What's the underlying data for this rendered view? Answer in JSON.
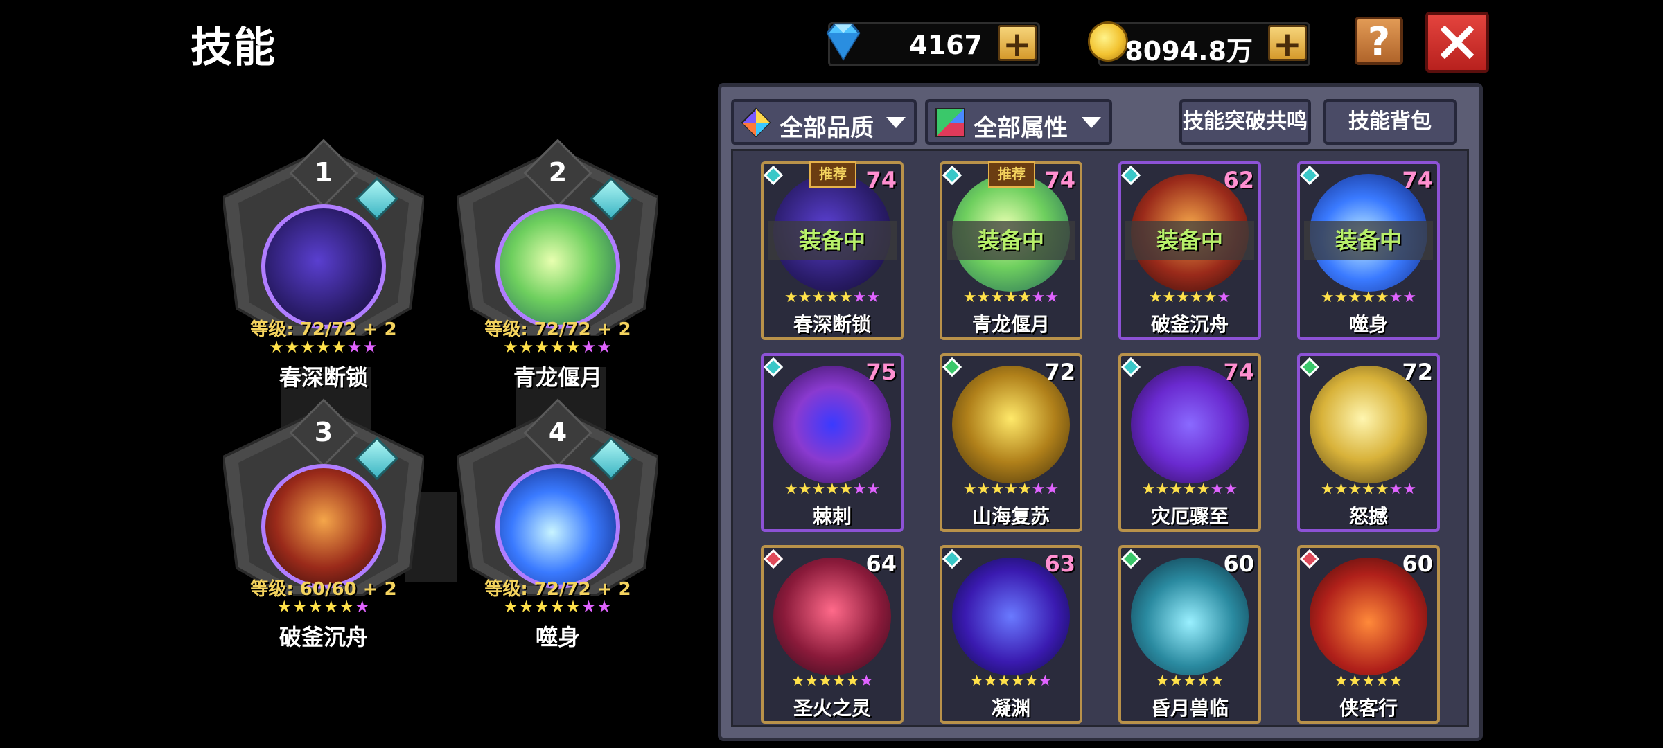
{
  "header": {
    "title": "技能"
  },
  "currency": {
    "gems": "4167",
    "gold": "8094.8万"
  },
  "colors": {
    "panel_bg": "#5c5d74",
    "card_gold_border": "#b9924a",
    "card_purple_border": "#8d52d6",
    "level_text": "#f4d35e",
    "equipped_text": "#b8f06a",
    "close_red": "#d12f2a"
  },
  "filters": {
    "quality": "全部品质",
    "attribute": "全部属性"
  },
  "actions": {
    "resonance": "技能突破共鸣",
    "bag": "技能背包"
  },
  "slots": [
    {
      "num": "1",
      "level": "等级: 72/72 + 2",
      "name": "春深断锁",
      "stars": [
        "y",
        "y",
        "y",
        "y",
        "y",
        "p",
        "p"
      ],
      "orb": "radial-gradient(circle at 45% 45%,#5a3fd0,#2a1c6a 60%,#120b2e)"
    },
    {
      "num": "2",
      "level": "等级: 72/72 + 2",
      "name": "青龙偃月",
      "stars": [
        "y",
        "y",
        "y",
        "y",
        "y",
        "p",
        "p"
      ],
      "orb": "radial-gradient(circle at 45% 45%,#e8ffb0,#6ecf5e 45%,#1d5f5a)"
    },
    {
      "num": "3",
      "level": "等级: 60/60 + 2",
      "name": "破釜沉舟",
      "stars": [
        "y",
        "y",
        "y",
        "y",
        "y",
        "p"
      ],
      "orb": "radial-gradient(circle at 50% 45%,#f4a64a,#9a2a1a 55%,#2a0a0a)"
    },
    {
      "num": "4",
      "level": "等级: 72/72 + 2",
      "name": "噬身",
      "stars": [
        "y",
        "y",
        "y",
        "y",
        "y",
        "p",
        "p"
      ],
      "orb": "radial-gradient(circle at 45% 55%,#c8f4ff,#3a7aff 45%,#0a1a6a)"
    }
  ],
  "cards": [
    {
      "level": "74",
      "name": "春深断锁",
      "equipped": "装备中",
      "recommended": "推荐",
      "stars": [
        "y",
        "y",
        "y",
        "y",
        "y",
        "p",
        "p"
      ],
      "border": "gold",
      "level_color": "#ff8fd0",
      "type": "teal",
      "orb": "radial-gradient(circle at 45% 45%,#5a3fd0,#2a1c6a 60%,#120b2e)"
    },
    {
      "level": "74",
      "name": "青龙偃月",
      "equipped": "装备中",
      "recommended": "推荐",
      "stars": [
        "y",
        "y",
        "y",
        "y",
        "y",
        "p",
        "p"
      ],
      "border": "gold",
      "level_color": "#ff8fd0",
      "type": "teal",
      "orb": "radial-gradient(circle at 45% 45%,#e8ffb0,#6ecf5e 45%,#1d5f5a)"
    },
    {
      "level": "62",
      "name": "破釜沉舟",
      "equipped": "装备中",
      "recommended": "",
      "stars": [
        "y",
        "y",
        "y",
        "y",
        "y",
        "p"
      ],
      "border": "purple",
      "level_color": "#ff8fd0",
      "type": "teal",
      "orb": "radial-gradient(circle at 50% 45%,#f4a64a,#9a2a1a 55%,#2a0a0a)"
    },
    {
      "level": "74",
      "name": "噬身",
      "equipped": "装备中",
      "recommended": "",
      "stars": [
        "y",
        "y",
        "y",
        "y",
        "y",
        "p",
        "p"
      ],
      "border": "purple",
      "level_color": "#ff8fd0",
      "type": "teal",
      "orb": "radial-gradient(circle at 45% 55%,#c8f4ff,#3a7aff 45%,#0a1a6a)"
    },
    {
      "level": "75",
      "name": "棘刺",
      "equipped": "",
      "recommended": "",
      "stars": [
        "y",
        "y",
        "y",
        "y",
        "y",
        "p",
        "p"
      ],
      "border": "purple",
      "level_color": "#ff8fd0",
      "type": "teal",
      "orb": "radial-gradient(circle at 50% 50%,#3a3aff,#8a3ad0 45%,#2a0a4a)"
    },
    {
      "level": "72",
      "name": "山海复苏",
      "equipped": "",
      "recommended": "",
      "stars": [
        "y",
        "y",
        "y",
        "y",
        "y",
        "p",
        "p"
      ],
      "border": "gold",
      "level_color": "#ffffff",
      "type": "green",
      "orb": "radial-gradient(circle at 50% 45%,#ffe96a,#b0801a 50%,#3a2a0a)"
    },
    {
      "level": "74",
      "name": "灾厄骤至",
      "equipped": "",
      "recommended": "",
      "stars": [
        "y",
        "y",
        "y",
        "y",
        "y",
        "p",
        "p"
      ],
      "border": "gold",
      "level_color": "#ff8fd0",
      "type": "teal",
      "orb": "radial-gradient(circle at 50% 50%,#8a6aff,#6a2ad0 50%,#2a0a4a)"
    },
    {
      "level": "72",
      "name": "怒撼",
      "equipped": "",
      "recommended": "",
      "stars": [
        "y",
        "y",
        "y",
        "y",
        "y",
        "p",
        "p"
      ],
      "border": "purple",
      "level_color": "#ffffff",
      "type": "green",
      "orb": "radial-gradient(circle at 45% 45%,#fff6b0,#d8b23a 45%,#3a2a0a)"
    },
    {
      "level": "64",
      "name": "圣火之灵",
      "equipped": "",
      "recommended": "",
      "stars": [
        "y",
        "y",
        "y",
        "y",
        "y",
        "p"
      ],
      "border": "gold",
      "level_color": "#ffffff",
      "type": "red",
      "orb": "radial-gradient(circle at 50% 45%,#ff6a8a,#8a1a3a 55%,#2a0a1a)"
    },
    {
      "level": "63",
      "name": "凝渊",
      "equipped": "",
      "recommended": "",
      "stars": [
        "y",
        "y",
        "y",
        "y",
        "y",
        "p"
      ],
      "border": "gold",
      "level_color": "#ff8fd0",
      "type": "teal",
      "orb": "radial-gradient(circle at 50% 50%,#6a7aff,#3a1ab0 55%,#0a0a3a)"
    },
    {
      "level": "60",
      "name": "昏月兽临",
      "equipped": "",
      "recommended": "",
      "stars": [
        "y",
        "y",
        "y",
        "y",
        "y"
      ],
      "border": "gold",
      "level_color": "#ffffff",
      "type": "green",
      "orb": "radial-gradient(circle at 50% 55%,#9af0ff,#2a8aa0 50%,#0a2a3a)"
    },
    {
      "level": "60",
      "name": "侠客行",
      "equipped": "",
      "recommended": "",
      "stars": [
        "y",
        "y",
        "y",
        "y",
        "y"
      ],
      "border": "gold",
      "level_color": "#ffffff",
      "type": "red",
      "orb": "radial-gradient(circle at 50% 55%,#ff8a3a,#b0201a 55%,#3a0a0a)"
    }
  ]
}
